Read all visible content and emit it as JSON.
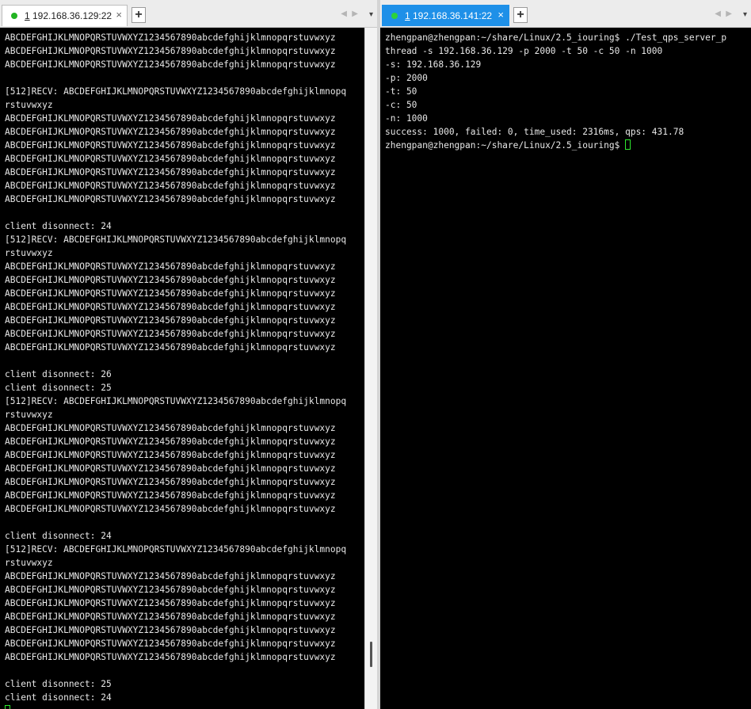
{
  "left_pane": {
    "tab": {
      "number": "1",
      "title": "192.168.36.129:22",
      "close": "×"
    },
    "add_tab": "+",
    "nav_prev": "◀",
    "nav_next": "▶",
    "menu": "▾",
    "scroll_position": 0.94,
    "terminal_text": "ABCDEFGHIJKLMNOPQRSTUVWXYZ1234567890abcdefghijklmnopqrstuvwxyz\nABCDEFGHIJKLMNOPQRSTUVWXYZ1234567890abcdefghijklmnopqrstuvwxyz\nABCDEFGHIJKLMNOPQRSTUVWXYZ1234567890abcdefghijklmnopqrstuvwxyz\n\n[512]RECV: ABCDEFGHIJKLMNOPQRSTUVWXYZ1234567890abcdefghijklmnopq\nrstuvwxyz\nABCDEFGHIJKLMNOPQRSTUVWXYZ1234567890abcdefghijklmnopqrstuvwxyz\nABCDEFGHIJKLMNOPQRSTUVWXYZ1234567890abcdefghijklmnopqrstuvwxyz\nABCDEFGHIJKLMNOPQRSTUVWXYZ1234567890abcdefghijklmnopqrstuvwxyz\nABCDEFGHIJKLMNOPQRSTUVWXYZ1234567890abcdefghijklmnopqrstuvwxyz\nABCDEFGHIJKLMNOPQRSTUVWXYZ1234567890abcdefghijklmnopqrstuvwxyz\nABCDEFGHIJKLMNOPQRSTUVWXYZ1234567890abcdefghijklmnopqrstuvwxyz\nABCDEFGHIJKLMNOPQRSTUVWXYZ1234567890abcdefghijklmnopqrstuvwxyz\n\nclient disonnect: 24\n[512]RECV: ABCDEFGHIJKLMNOPQRSTUVWXYZ1234567890abcdefghijklmnopq\nrstuvwxyz\nABCDEFGHIJKLMNOPQRSTUVWXYZ1234567890abcdefghijklmnopqrstuvwxyz\nABCDEFGHIJKLMNOPQRSTUVWXYZ1234567890abcdefghijklmnopqrstuvwxyz\nABCDEFGHIJKLMNOPQRSTUVWXYZ1234567890abcdefghijklmnopqrstuvwxyz\nABCDEFGHIJKLMNOPQRSTUVWXYZ1234567890abcdefghijklmnopqrstuvwxyz\nABCDEFGHIJKLMNOPQRSTUVWXYZ1234567890abcdefghijklmnopqrstuvwxyz\nABCDEFGHIJKLMNOPQRSTUVWXYZ1234567890abcdefghijklmnopqrstuvwxyz\nABCDEFGHIJKLMNOPQRSTUVWXYZ1234567890abcdefghijklmnopqrstuvwxyz\n\nclient disonnect: 26\nclient disonnect: 25\n[512]RECV: ABCDEFGHIJKLMNOPQRSTUVWXYZ1234567890abcdefghijklmnopq\nrstuvwxyz\nABCDEFGHIJKLMNOPQRSTUVWXYZ1234567890abcdefghijklmnopqrstuvwxyz\nABCDEFGHIJKLMNOPQRSTUVWXYZ1234567890abcdefghijklmnopqrstuvwxyz\nABCDEFGHIJKLMNOPQRSTUVWXYZ1234567890abcdefghijklmnopqrstuvwxyz\nABCDEFGHIJKLMNOPQRSTUVWXYZ1234567890abcdefghijklmnopqrstuvwxyz\nABCDEFGHIJKLMNOPQRSTUVWXYZ1234567890abcdefghijklmnopqrstuvwxyz\nABCDEFGHIJKLMNOPQRSTUVWXYZ1234567890abcdefghijklmnopqrstuvwxyz\nABCDEFGHIJKLMNOPQRSTUVWXYZ1234567890abcdefghijklmnopqrstuvwxyz\n\nclient disonnect: 24\n[512]RECV: ABCDEFGHIJKLMNOPQRSTUVWXYZ1234567890abcdefghijklmnopq\nrstuvwxyz\nABCDEFGHIJKLMNOPQRSTUVWXYZ1234567890abcdefghijklmnopqrstuvwxyz\nABCDEFGHIJKLMNOPQRSTUVWXYZ1234567890abcdefghijklmnopqrstuvwxyz\nABCDEFGHIJKLMNOPQRSTUVWXYZ1234567890abcdefghijklmnopqrstuvwxyz\nABCDEFGHIJKLMNOPQRSTUVWXYZ1234567890abcdefghijklmnopqrstuvwxyz\nABCDEFGHIJKLMNOPQRSTUVWXYZ1234567890abcdefghijklmnopqrstuvwxyz\nABCDEFGHIJKLMNOPQRSTUVWXYZ1234567890abcdefghijklmnopqrstuvwxyz\nABCDEFGHIJKLMNOPQRSTUVWXYZ1234567890abcdefghijklmnopqrstuvwxyz\n\nclient disonnect: 25\nclient disonnect: 24"
  },
  "right_pane": {
    "tab": {
      "number": "1",
      "title": "192.168.36.141:22",
      "close": "×"
    },
    "add_tab": "+",
    "nav_prev": "◀",
    "nav_next": "▶",
    "menu": "▾",
    "terminal_text": "zhengpan@zhengpan:~/share/Linux/2.5_iouring$ ./Test_qps_server_p\nthread -s 192.168.36.129 -p 2000 -t 50 -c 50 -n 1000\n-s: 192.168.36.129\n-p: 2000\n-t: 50\n-c: 50\n-n: 1000\nsuccess: 1000, failed: 0, time_used: 2316ms, qps: 431.78\nzhengpan@zhengpan:~/share/Linux/2.5_iouring$ "
  }
}
